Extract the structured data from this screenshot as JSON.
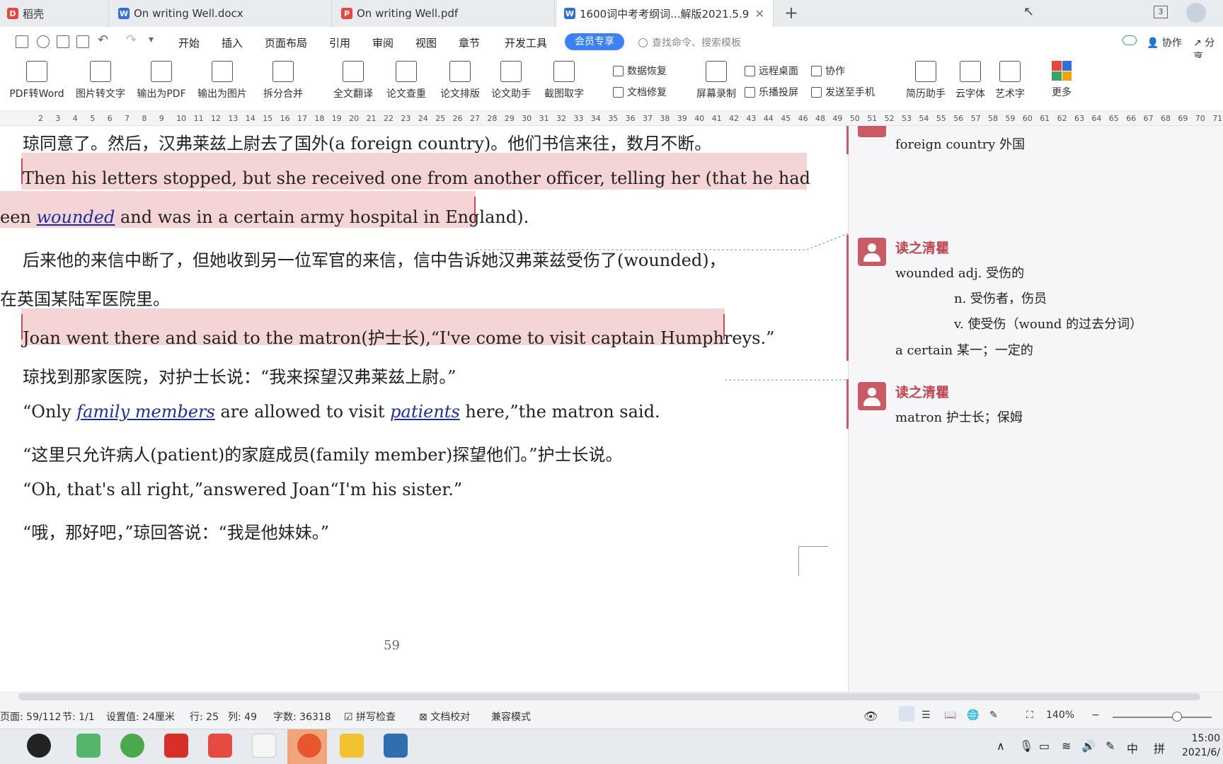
{
  "tabs": [
    {
      "label": "稻壳",
      "icon": "docer-icon",
      "color": "#e8453c"
    },
    {
      "label": "On writing Well.docx",
      "icon": "word-doc-icon",
      "color": "#2f6fdb"
    },
    {
      "label": "On writing Well.pdf",
      "icon": "pdf-icon",
      "color": "#e8453c"
    },
    {
      "label": "1600词中考考纲词...解版2021.5.9",
      "icon": "word-doc-icon",
      "color": "#2f6fdb",
      "active": true
    }
  ],
  "window_badge": "3",
  "menu": {
    "items": [
      "开始",
      "插入",
      "页面布局",
      "引用",
      "审阅",
      "视图",
      "章节",
      "开发工具"
    ],
    "member_button": "会员专享",
    "search_placeholder": "查找命令、搜索模板",
    "collab": "协作",
    "share": "分享"
  },
  "ribbon": {
    "big_buttons": [
      "PDF转Word",
      "图片转文字",
      "输出为PDF",
      "输出为图片",
      "拆分合并",
      "全文翻译",
      "论文查重",
      "论文排版",
      "论文助手",
      "截图取字",
      "屏幕录制",
      "简历助手",
      "云字体",
      "艺术字",
      "更多"
    ],
    "small_buttons": [
      "数据恢复",
      "文档修复",
      "远程桌面",
      "乐播投屏",
      "协作",
      "发送至手机"
    ]
  },
  "ruler": {
    "numbers": [
      "2",
      "3",
      "4",
      "5",
      "6",
      "7",
      "8",
      "9",
      "10",
      "11",
      "12",
      "13",
      "14",
      "15",
      "16",
      "17",
      "18",
      "19",
      "20",
      "21",
      "22",
      "23",
      "24",
      "25",
      "26",
      "27",
      "28",
      "29",
      "30",
      "31",
      "32",
      "33",
      "34",
      "35",
      "36",
      "37",
      "38",
      "39",
      "40",
      "41",
      "42",
      "43",
      "44",
      "45",
      "46",
      "48",
      "49",
      "50",
      "51",
      "52",
      "53",
      "54",
      "55",
      "56",
      "57",
      "58",
      "59",
      "60",
      "61",
      "62",
      "63",
      "64",
      "65",
      "66",
      "67",
      "68",
      "69",
      "70",
      "71"
    ]
  },
  "document": {
    "p1": "琼同意了。然后，汉弗莱兹上尉去了国外(a foreign country)。他们书信来往，数月不断。",
    "p2a": "Then his letters stopped, but she received one from another officer, telling her (that he had",
    "p2b_pre": "een ",
    "p2b_link": "wounded",
    "p2b_post": " and was in a certain army hospital in England).",
    "p3a": "后来他的来信中断了，但她收到另一位军官的来信，信中告诉她汉弗莱兹受伤了(wounded)，",
    "p3b": "在英国某陆军医院里。",
    "p4": "Joan went there and said to the matron(护士长),“I've come to visit captain Humphreys.”",
    "p5": "琼找到那家医院，对护士长说：“我来探望汉弗莱兹上尉。”",
    "p6_pre": "“Only ",
    "p6_link1": "family members",
    "p6_mid": " are allowed to visit ",
    "p6_link2": "patients",
    "p6_post": " here,”the matron said.",
    "p7": "“这里只允许病人(patient)的家庭成员(family member)探望他们。”护士长说。",
    "p8": "“Oh, that's all right,”answered Joan“I'm his sister.”",
    "p9": "“哦，那好吧，”琼回答说：“我是他妹妹。”",
    "page_number": "59"
  },
  "comments": {
    "c0_text": "foreign country  外国",
    "c1_author": "读之清瞿",
    "c1_lines": [
      "wounded adj.  受伤的",
      "n.  受伤者，伤员",
      "v.  使受伤（wound 的过去分词）",
      "a certain  某一；一定的"
    ],
    "c2_author": "读之清瞿",
    "c2_text": "matron  护士长；保姆"
  },
  "status": {
    "page": "页面: 59/112",
    "section": "节: 1/1",
    "setting": "设置值: 24厘米",
    "row": "行: 25",
    "col": "列: 49",
    "words": "字数: 36318",
    "spell": "拼写检查",
    "proof": "文档校对",
    "compat": "兼容模式",
    "zoom": "140%"
  },
  "taskbar": {
    "tray_ime1": "中",
    "tray_ime2": "拼",
    "time": "15:00",
    "date": "2021/6/"
  },
  "colors": {
    "accent": "#3b82f6",
    "highlight": "#f5d4d6",
    "comment_red": "#c85b63",
    "link_blue": "#1c2f9e"
  }
}
